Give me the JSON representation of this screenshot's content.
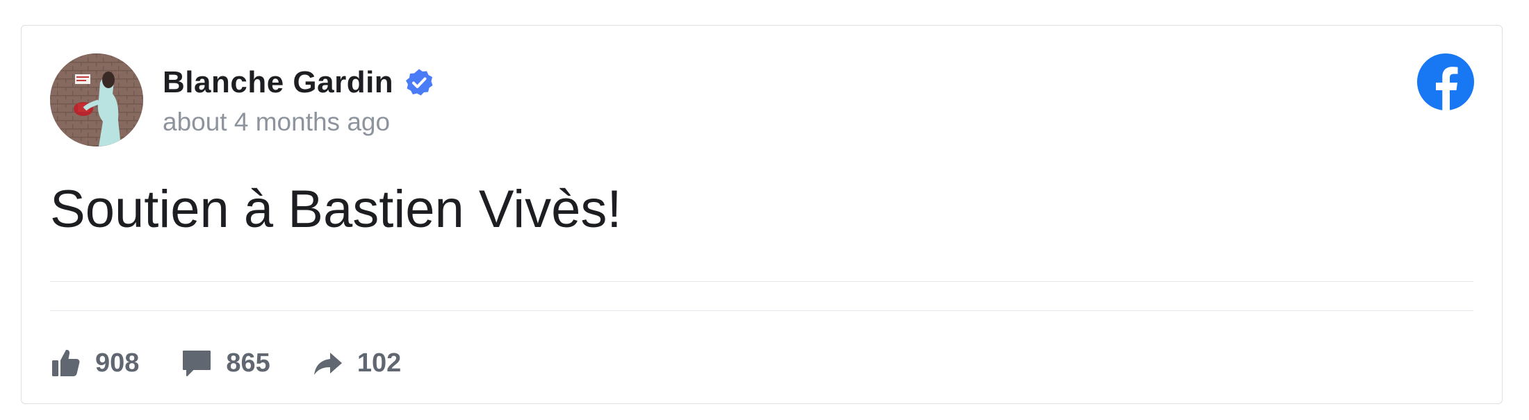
{
  "post": {
    "author": "Blanche Gardin",
    "verified": true,
    "timestamp": "about 4 months ago",
    "text": "Soutien à Bastien Vivès!",
    "platform_icon": "facebook-logo-icon",
    "avatar": "profile-photo"
  },
  "stats": [
    {
      "icon": "thumbs-up-icon",
      "count": "908"
    },
    {
      "icon": "comment-bubble-icon",
      "count": "865"
    },
    {
      "icon": "share-arrow-icon",
      "count": "102"
    }
  ],
  "colors": {
    "brand": "#1877f2",
    "verified": "#4a7cf7",
    "text": "#1c1e21",
    "muted": "#8d949e",
    "stat": "#606770",
    "border": "#dddfe2"
  }
}
